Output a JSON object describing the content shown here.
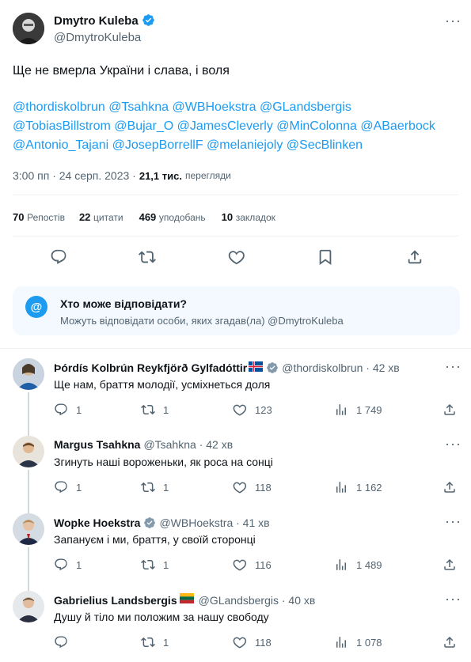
{
  "main_tweet": {
    "author_name": "Dmytro Kuleba",
    "author_handle": "@DmytroKuleba",
    "text": "Ще не вмерла України і слава, і воля",
    "mentions_line1": "@thordiskolbrun @Tsahkna @WBHoekstra @GLandsbergis",
    "mentions_line2": "@TobiasBillstrom @Bujar_O @JamesCleverly @MinColonna @ABaerbock",
    "mentions_line3": "@Antonio_Tajani @JosepBorrellF @melaniejoly @SecBlinken",
    "time": "3:00 пп · 24 серп. 2023 ·",
    "views_count": "21,1 тис.",
    "views_label": "перегляди"
  },
  "stats": {
    "reposts_count": "70",
    "reposts_label": "Репостів",
    "quotes_count": "22",
    "quotes_label": "цитати",
    "likes_count": "469",
    "likes_label": "уподобань",
    "bookmarks_count": "10",
    "bookmarks_label": "закладок"
  },
  "reply_notice": {
    "title": "Хто може відповідати?",
    "subtitle": "Можуть відповідати особи, яких згадав(ла) @DmytroKuleba"
  },
  "replies": [
    {
      "name": "Þórdís Kolbrún Reykfjörð Gylfadóttir",
      "flag": "iceland-flag",
      "handle": "@thordiskolbrun · 42 хв",
      "text": "Ще нам, браття молодії, усміхнеться доля",
      "replies": "1",
      "reposts": "1",
      "likes": "123",
      "views": "1 749"
    },
    {
      "name": "Margus Tsahkna",
      "handle": "@Tsahkna · 42 хв",
      "text": "Згинуть наші вороженьки, як роса на сонці",
      "replies": "1",
      "reposts": "1",
      "likes": "118",
      "views": "1 162"
    },
    {
      "name": "Wopke Hoekstra",
      "handle": "@WBHoekstra · 41 хв",
      "text": "Запануєм і ми, браття, у своїй сторонці",
      "replies": "1",
      "reposts": "1",
      "likes": "116",
      "views": "1 489"
    },
    {
      "name": "Gabrielius Landsbergis",
      "flag": "lithuania-flag",
      "handle": "@GLandsbergis · 40 хв",
      "text": "Душу й тіло ми положим за нашу свободу",
      "replies": "",
      "reposts": "1",
      "likes": "118",
      "views": "1 078"
    }
  ],
  "colors": {
    "accent": "#1d9bf0",
    "muted": "#536471",
    "text": "#0f1419",
    "border": "#eff3f4"
  }
}
